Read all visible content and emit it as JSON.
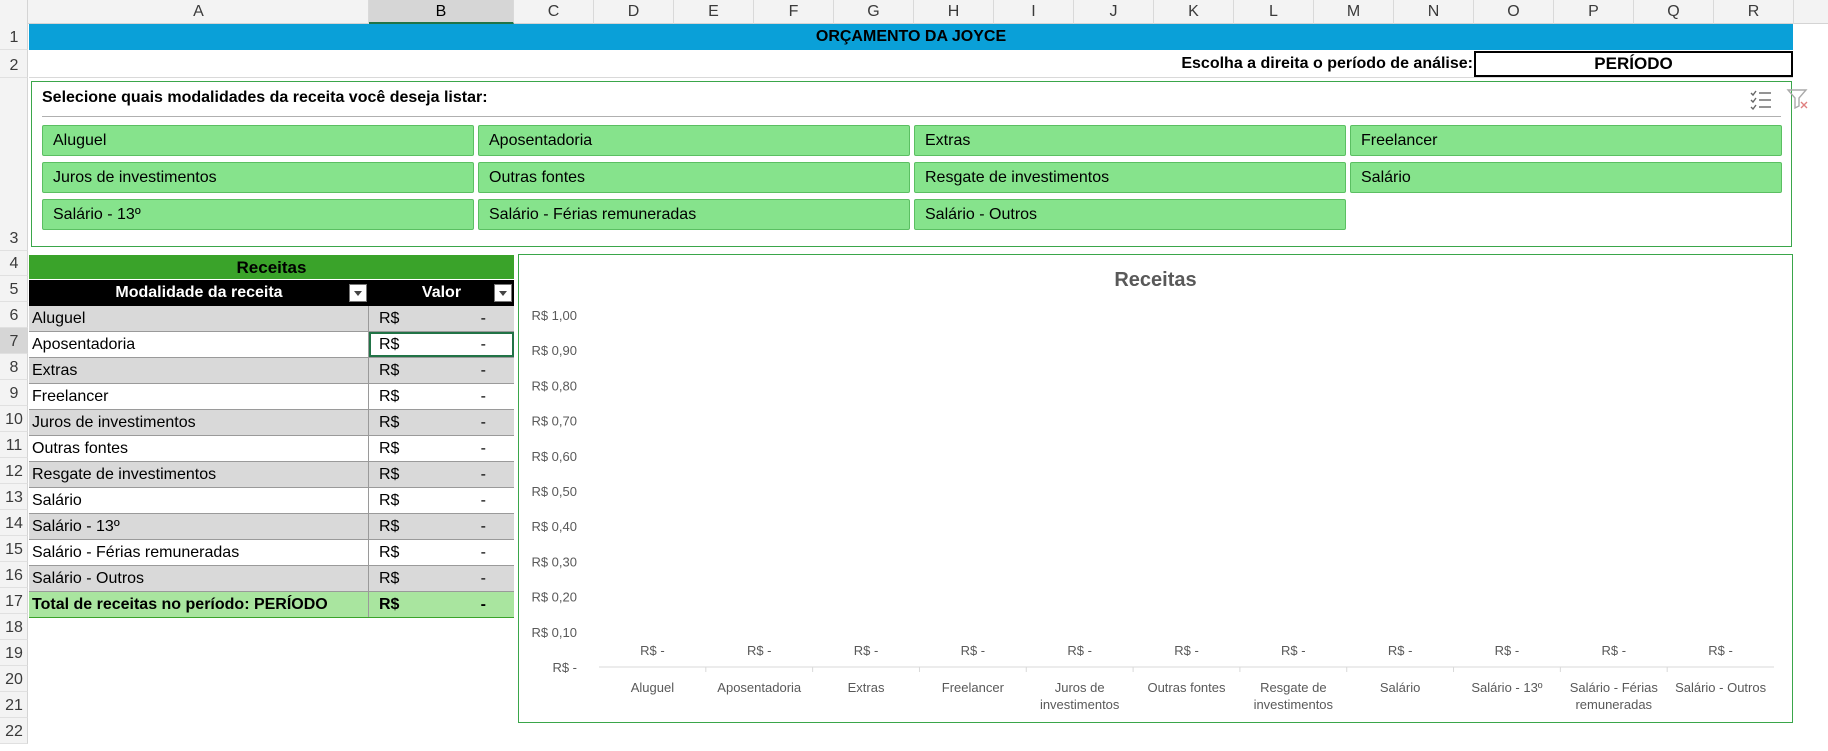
{
  "columns": [
    "A",
    "B",
    "C",
    "D",
    "E",
    "F",
    "G",
    "H",
    "I",
    "J",
    "K",
    "L",
    "M",
    "N",
    "O",
    "P",
    "Q",
    "R"
  ],
  "rows": [
    "1",
    "2",
    "3",
    "4",
    "5",
    "6",
    "7",
    "8",
    "9",
    "10",
    "11",
    "12",
    "13",
    "14",
    "15",
    "16",
    "17",
    "18",
    "19",
    "20",
    "21",
    "22"
  ],
  "title": "ORÇAMENTO DA JOYCE",
  "period": {
    "label": "Escolha a direita o período de análise:",
    "value": "PERÍODO"
  },
  "slicer": {
    "title": "Selecione quais modalidades da receita você deseja listar:",
    "items": [
      "Aluguel",
      "Aposentadoria",
      "Extras",
      "Freelancer",
      "Juros de investimentos",
      "Outras fontes",
      "Resgate de investimentos",
      "Salário",
      "Salário - 13º",
      "Salário - Férias remuneradas",
      "Salário - Outros"
    ],
    "icons": [
      "multi-select-icon",
      "clear-filter-icon"
    ]
  },
  "table": {
    "header": "Receitas",
    "col1": "Modalidade da receita",
    "col2": "Valor",
    "rows": [
      {
        "name": "Aluguel",
        "cur": "R$",
        "val": "-"
      },
      {
        "name": "Aposentadoria",
        "cur": "R$",
        "val": "-"
      },
      {
        "name": "Extras",
        "cur": "R$",
        "val": "-"
      },
      {
        "name": "Freelancer",
        "cur": "R$",
        "val": "-"
      },
      {
        "name": "Juros de investimentos",
        "cur": "R$",
        "val": "-"
      },
      {
        "name": "Outras fontes",
        "cur": "R$",
        "val": "-"
      },
      {
        "name": "Resgate de investimentos",
        "cur": "R$",
        "val": "-"
      },
      {
        "name": "Salário",
        "cur": "R$",
        "val": "-"
      },
      {
        "name": "Salário - 13º",
        "cur": "R$",
        "val": "-"
      },
      {
        "name": "Salário - Férias remuneradas",
        "cur": "R$",
        "val": "-"
      },
      {
        "name": "Salário - Outros",
        "cur": "R$",
        "val": "-"
      }
    ],
    "total": {
      "name": "Total de receitas no período: PERÍODO",
      "cur": "R$",
      "val": "-"
    }
  },
  "chart_data": {
    "type": "bar",
    "title": "Receitas",
    "categories": [
      [
        "Aluguel"
      ],
      [
        "Aposentadoria"
      ],
      [
        "Extras"
      ],
      [
        "Freelancer"
      ],
      [
        "Juros de",
        "investimentos"
      ],
      [
        "Outras fontes"
      ],
      [
        "Resgate de",
        "investimentos"
      ],
      [
        "Salário"
      ],
      [
        "Salário - 13º"
      ],
      [
        "Salário - Férias",
        "remuneradas"
      ],
      [
        "Salário - Outros"
      ]
    ],
    "values": [
      0,
      0,
      0,
      0,
      0,
      0,
      0,
      0,
      0,
      0,
      0
    ],
    "data_labels": [
      "R$ -",
      "R$ -",
      "R$ -",
      "R$ -",
      "R$ -",
      "R$ -",
      "R$ -",
      "R$ -",
      "R$ -",
      "R$ -",
      "R$ -"
    ],
    "y_ticks": [
      "R$ -",
      "R$ 0,10",
      "R$ 0,20",
      "R$ 0,30",
      "R$ 0,40",
      "R$ 0,50",
      "R$ 0,60",
      "R$ 0,70",
      "R$ 0,80",
      "R$ 0,90",
      "R$ 1,00"
    ],
    "ylim": [
      0,
      1
    ]
  }
}
